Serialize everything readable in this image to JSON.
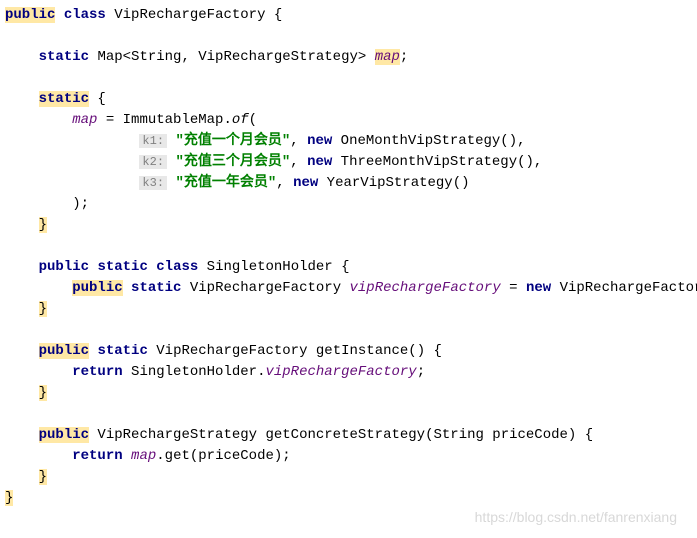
{
  "code": {
    "l1_public": "public",
    "l1_class": "class",
    "l1_name": "VipRechargeFactory {",
    "l2_static": "static",
    "l2_type": "Map<String, VipRechargeStrategy>",
    "l2_field": "map",
    "l2_semi": ";",
    "l3_static": "static",
    "l3_brace": " {",
    "l4_field": "map",
    "l4_rest": " = ImmutableMap.",
    "l4_of": "of",
    "l4_paren": "(",
    "l5_hint": "k1:",
    "l5_str": "\"充值一个月会员\"",
    "l5_comma": ", ",
    "l5_new": "new",
    "l5_rest": " OneMonthVipStrategy(),",
    "l6_hint": "k2:",
    "l6_str": "\"充值三个月会员\"",
    "l6_comma": ", ",
    "l6_new": "new",
    "l6_rest": " ThreeMonthVipStrategy(),",
    "l7_hint": "k3:",
    "l7_str": "\"充值一年会员\"",
    "l7_comma": ", ",
    "l7_new": "new",
    "l7_rest": " YearVipStrategy()",
    "l8_close": ");",
    "l9_brace": "}",
    "l10_public": "public",
    "l10_static": "static",
    "l10_class": "class",
    "l10_rest": " SingletonHolder {",
    "l11_public": "public",
    "l11_static": "static",
    "l11_type": " VipRechargeFactory ",
    "l11_field": "vipRechargeFactory",
    "l11_eq": " = ",
    "l11_new": "new",
    "l11_rest": " VipRechargeFactory();",
    "l12_brace": "}",
    "l13_public": "public",
    "l13_static": "static",
    "l13_rest": " VipRechargeFactory getInstance() {",
    "l14_return": "return",
    "l14_rest": " SingletonHolder.",
    "l14_field": "vipRechargeFactory",
    "l14_semi": ";",
    "l15_brace": "}",
    "l16_public": "public",
    "l16_rest": " VipRechargeStrategy getConcreteStrategy(String priceCode) {",
    "l17_return": "return",
    "l17_sp": " ",
    "l17_field": "map",
    "l17_rest": ".get(priceCode);",
    "l18_brace": "}",
    "l19_brace": "}"
  },
  "watermark": "https://blog.csdn.net/fanrenxiang"
}
